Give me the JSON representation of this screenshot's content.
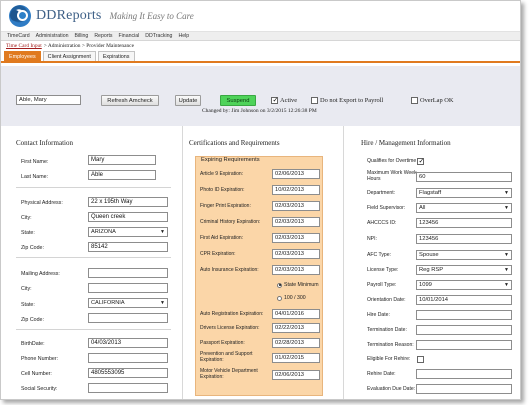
{
  "app": {
    "brand": "DDReports",
    "tagline": "Making It Easy to Care"
  },
  "nav": {
    "items": [
      "TimeCard",
      "Administration",
      "Billing",
      "Reports",
      "Financial",
      "DDTracking",
      "Help"
    ]
  },
  "breadcrumb": {
    "link": "Time Card Input",
    "rest": "> Administration > Provider Maintenance"
  },
  "tabs": [
    {
      "label": "Employees",
      "active": true
    },
    {
      "label": "Client Assignment",
      "active": false
    },
    {
      "label": "Expirations",
      "active": false
    }
  ],
  "toolbar": {
    "employee_value": "Able, Mary",
    "refresh_label": "Refresh Amcheck",
    "update_label": "Update",
    "suspend_label": "Suspend",
    "active_label": "Active",
    "active_checked": true,
    "no_export_label": "Do not Export to Payroll",
    "no_export_checked": false,
    "overlap_label": "OverLap OK",
    "overlap_checked": false,
    "changed_text": "Changed by: Jim Johnson on 3/2/2015 12:26:38 PM"
  },
  "contact": {
    "title": "Contact Information",
    "first_name_label": "First Name:",
    "first_name": "Mary",
    "last_name_label": "Last Name:",
    "last_name": "Able",
    "physical_address_label": "Physical Address:",
    "physical_address": "22 x 195th Way",
    "city_label": "City:",
    "city": "Queen creek",
    "state_label": "State:",
    "state": "ARIZONA",
    "zip_label": "Zip Code:",
    "zip": "85142",
    "mailing_address_label": "Mailing Address:",
    "mailing_address": "",
    "mailing_city_label": "City:",
    "mailing_city": "",
    "mailing_state_label": "State:",
    "mailing_state": "CALIFORNIA",
    "mailing_zip_label": "Zip Code:",
    "mailing_zip": "",
    "birthdate_label": "BirthDate:",
    "birthdate": "04/03/2013",
    "phone_label": "Phone Number:",
    "phone": "",
    "cell_label": "Cell Number:",
    "cell": "4805553095",
    "ssn_label": "Social Security:",
    "ssn": ""
  },
  "certifications": {
    "title": "Certifications and Requirements",
    "box_title": "Expiring Requirements",
    "items": [
      {
        "label": "Article 9 Expiration:",
        "value": "02/06/2013"
      },
      {
        "label": "Photo ID Expiration:",
        "value": "10/02/2013"
      },
      {
        "label": "Finger Print Expiration:",
        "value": "02/03/2013"
      },
      {
        "label": "Criminal History Expiration:",
        "value": "02/03/2013"
      },
      {
        "label": "First Aid Expiration:",
        "value": "02/03/2013"
      },
      {
        "label": "CPR Expiration:",
        "value": "02/03/2013"
      },
      {
        "label": "Auto Insurance Expiration:",
        "value": "02/03/2013"
      }
    ],
    "radio_state_min": "State Minimum",
    "radio_100_300": "100 / 300",
    "items2": [
      {
        "label": "Auto Registration Expiration:",
        "value": "04/01/2016"
      },
      {
        "label": "Drivers License Expiration:",
        "value": "02/22/2013"
      },
      {
        "label": "Passport Expiration:",
        "value": "02/28/2013"
      },
      {
        "label": "Prevention and Support Expiration:",
        "value": "01/02/2015"
      },
      {
        "label": "Motor Vehicle Department Expiration:",
        "value": "02/06/2013"
      }
    ]
  },
  "hire": {
    "title": "Hire / Management Information",
    "qualifies_label": "Qualifies for Overtime",
    "qualifies_checked": true,
    "max_hours_label": "Maximum Work Week Hours",
    "max_hours": "60",
    "department_label": "Department:",
    "department": "Flagstaff",
    "supervisor_label": "Field Supervisor:",
    "supervisor": "All",
    "ahcccs_label": "AHCCCS ID:",
    "ahcccs": "123456",
    "npi_label": "NPI:",
    "npi": "123456",
    "afc_label": "AFC Type:",
    "afc": "Spouse",
    "license_label": "License Type:",
    "license": "Reg RSP",
    "payroll_label": "Payroll Type:",
    "payroll": "1099",
    "orientation_label": "Orientation Date:",
    "orientation": "10/01/2014",
    "hire_date_label": "Hire Date:",
    "hire_date": "",
    "termination_label": "Termination Date:",
    "termination": "",
    "term_reason_label": "Termination Reason:",
    "term_reason": "",
    "rehire_label": "Eligible For Rehire:",
    "rehire_checked": false,
    "rehire_date_label": "Rehire Date:",
    "rehire_date": "",
    "eval_label": "Evaluation Due Date:",
    "eval": ""
  }
}
